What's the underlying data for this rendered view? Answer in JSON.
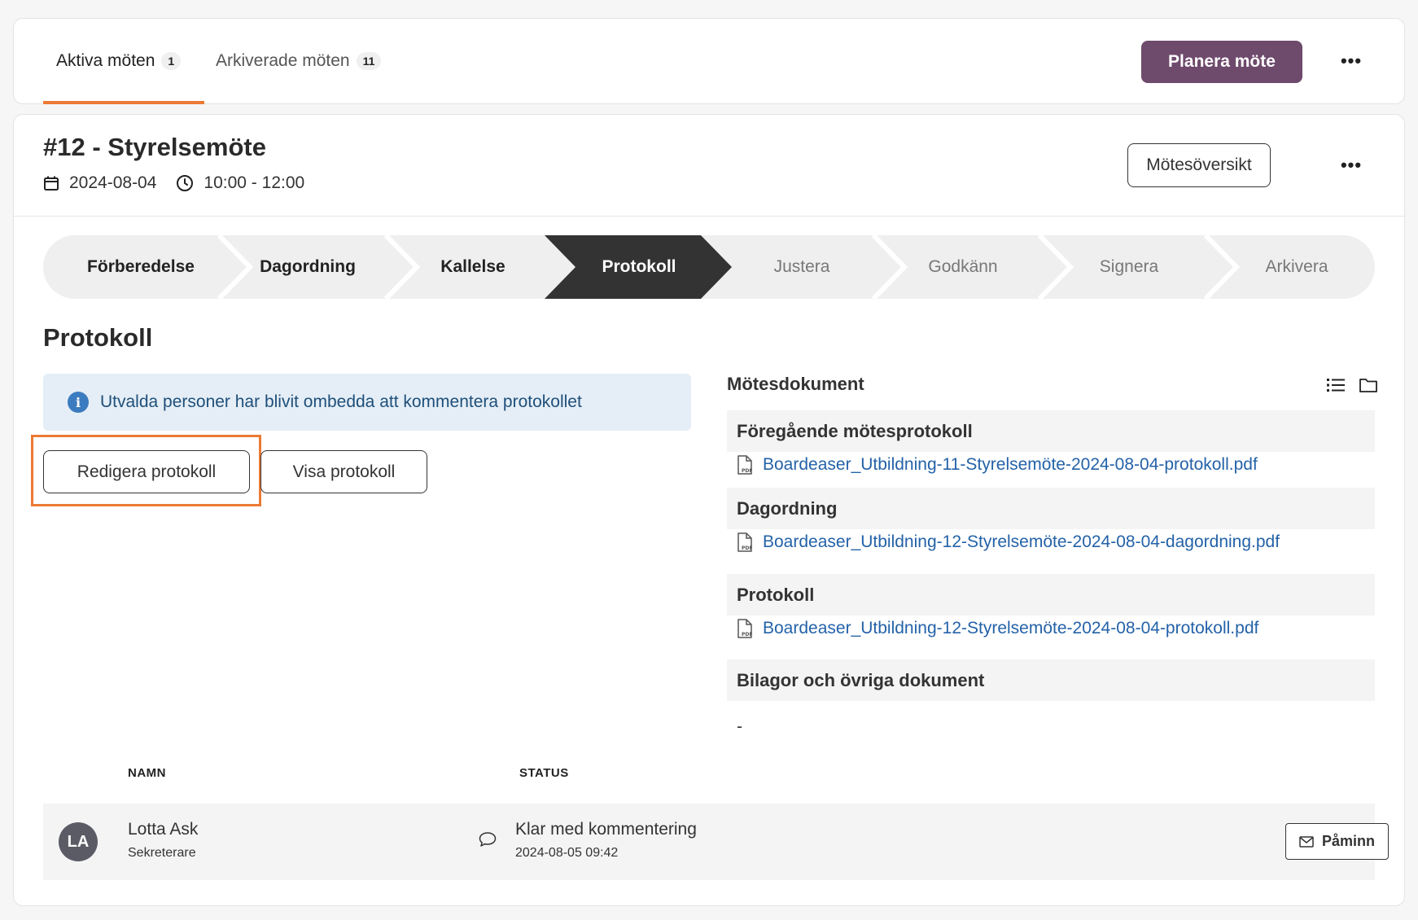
{
  "tabs": [
    {
      "label": "Aktiva möten",
      "count": "1"
    },
    {
      "label": "Arkiverade möten",
      "count": "11"
    }
  ],
  "top_actions": {
    "plan_label": "Planera möte",
    "more_label": "•••"
  },
  "meeting": {
    "title": "#12 - Styrelsemöte",
    "date": "2024-08-04",
    "time": "10:00 - 12:00",
    "overview_label": "Mötesöversikt",
    "more_label": "•••"
  },
  "steps": [
    {
      "label": "Förberedelse",
      "state": "done"
    },
    {
      "label": "Dagordning",
      "state": "done"
    },
    {
      "label": "Kallelse",
      "state": "done"
    },
    {
      "label": "Protokoll",
      "state": "current"
    },
    {
      "label": "Justera",
      "state": "future"
    },
    {
      "label": "Godkänn",
      "state": "future"
    },
    {
      "label": "Signera",
      "state": "future"
    },
    {
      "label": "Arkivera",
      "state": "future"
    }
  ],
  "colors": {
    "accent": "#ec7a34",
    "primary": "#6e4a6c",
    "step_current": "#333333",
    "step_bg": "#efefef",
    "link": "#2462a8"
  },
  "protokoll": {
    "title": "Protokoll",
    "info_icon": "i",
    "info_text": "Utvalda personer har blivit ombedda att kommentera protokollet",
    "edit_label": "Redigera protokoll",
    "view_label": "Visa protokoll"
  },
  "documents": {
    "title": "Mötesdokument",
    "sections": [
      {
        "heading": "Föregående mötesprotokoll",
        "file": "Boardeaser_Utbildning-11-Styrelsemöte-2024-08-04-protokoll.pdf"
      },
      {
        "heading": "Dagordning",
        "file": "Boardeaser_Utbildning-12-Styrelsemöte-2024-08-04-dagordning.pdf"
      },
      {
        "heading": "Protokoll",
        "file": "Boardeaser_Utbildning-12-Styrelsemöte-2024-08-04-protokoll.pdf"
      },
      {
        "heading": "Bilagor och övriga dokument",
        "empty": "-"
      }
    ]
  },
  "table": {
    "headers": {
      "name": "NAMN",
      "status": "STATUS"
    },
    "rows": [
      {
        "initials": "LA",
        "name": "Lotta Ask",
        "role": "Sekreterare",
        "status": "Klar med kommentering",
        "timestamp": "2024-08-05 09:42",
        "remind_label": "Påminn"
      }
    ]
  }
}
